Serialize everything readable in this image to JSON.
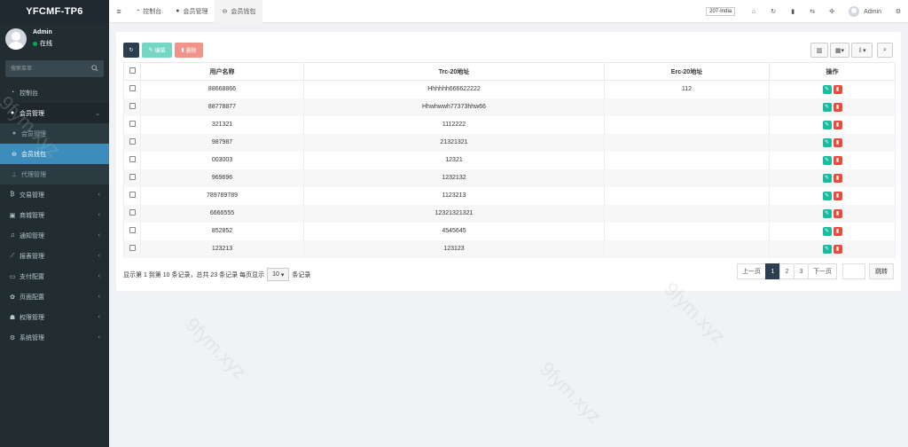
{
  "app": {
    "brand": "YFCMF-TP6"
  },
  "user": {
    "name": "Admin",
    "status": "在线"
  },
  "search": {
    "placeholder": "搜索菜单"
  },
  "menu": {
    "dashboard": "控制台",
    "member_mgmt": "会员管理",
    "member_mgmt_sub": "会员管理",
    "member_wallet": "会员钱包",
    "agent_mgmt": "代理管理",
    "trade_mgmt": "交易管理",
    "mall_mgmt": "商城管理",
    "notice_mgmt": "通知管理",
    "report_mgmt": "报表管理",
    "pay_config": "支付配置",
    "page_config": "页面配置",
    "perm_mgmt": "权限管理",
    "sys_mgmt": "系统管理"
  },
  "topbar": {
    "tabs": [
      "控制台",
      "会员管理",
      "会员钱包"
    ],
    "lang": "207-India",
    "admin": "Admin"
  },
  "toolbar": {
    "edit_label": "编辑",
    "delete_label": "删除"
  },
  "table": {
    "headers": [
      "用户名称",
      "Trc-20地址",
      "Erc-20地址",
      "操作"
    ],
    "rows": [
      [
        "88668866",
        "Hhhhhh666622222",
        "112"
      ],
      [
        "88778877",
        "Hhwhwwh77373hhw66",
        ""
      ],
      [
        "321321",
        "1112222",
        ""
      ],
      [
        "987987",
        "21321321",
        ""
      ],
      [
        "003003",
        "12321",
        ""
      ],
      [
        "969696",
        "1232132",
        ""
      ],
      [
        "789789789",
        "1123213",
        ""
      ],
      [
        "6666555",
        "12321321321",
        ""
      ],
      [
        "852852",
        "4545645",
        ""
      ],
      [
        "123213",
        "123123",
        ""
      ]
    ]
  },
  "footer": {
    "info_prefix": "显示第 1 到第 10 条记录，总共 23 条记录 每页显示",
    "page_size": "10",
    "info_suffix": "条记录"
  },
  "pagination": {
    "prev": "上一页",
    "pages": [
      "1",
      "2",
      "3"
    ],
    "next": "下一页",
    "jump": "跳转"
  },
  "watermark": "9fym.xyz",
  "colors": {
    "sidebar": "#222d32",
    "active": "#3c8dbc",
    "success": "#18bc9c",
    "danger": "#e74c3c",
    "primary": "#2c3e50"
  }
}
